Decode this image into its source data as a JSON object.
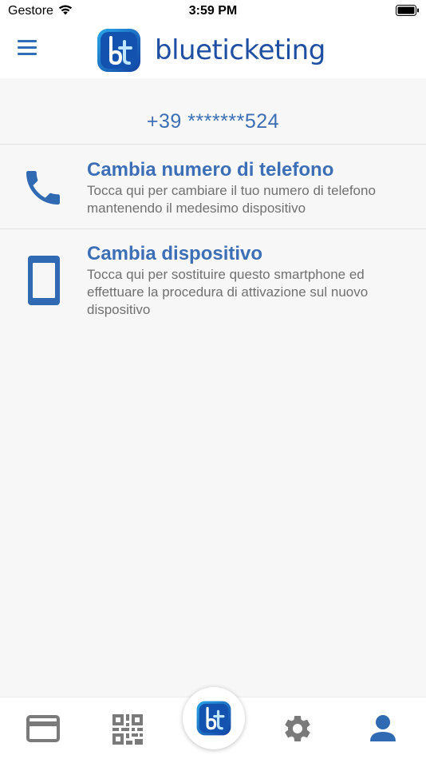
{
  "status_bar": {
    "carrier": "Gestore",
    "time": "3:59 PM"
  },
  "header": {
    "menu_icon": "hamburger-menu-icon",
    "logo_text": "blueticketing"
  },
  "phone": {
    "masked_number": "+39 *******524"
  },
  "options": [
    {
      "icon": "phone-icon",
      "title": "Cambia numero di telefono",
      "description": "Tocca qui per cambiare il tuo numero di telefono mantenendo il medesimo dispositivo"
    },
    {
      "icon": "smartphone-icon",
      "title": "Cambia dispositivo",
      "description": "Tocca qui per sostituire questo smartphone ed effettuare la procedura di attivazione sul nuovo dispositivo"
    }
  ],
  "tabbar": {
    "tabs": [
      "credit-card-icon",
      "qr-code-icon",
      "blueticketing-logo-icon",
      "gear-icon",
      "user-icon"
    ],
    "active_tab": "user-icon"
  },
  "colors": {
    "accent": "#3c6fb6",
    "brand_dark": "#1e4fa3",
    "inactive_icon": "#7a7a7a",
    "background": "#f7f7f7"
  }
}
